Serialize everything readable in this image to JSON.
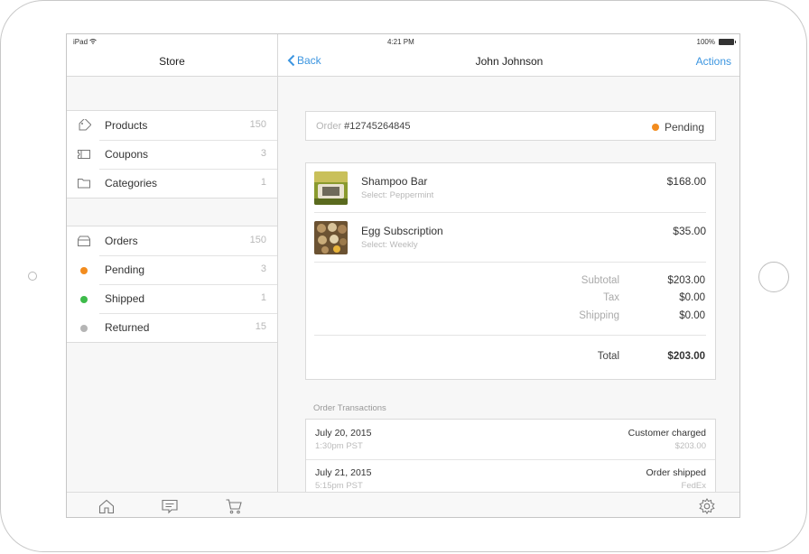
{
  "status_bar": {
    "device": "iPad",
    "time": "4:21 PM",
    "battery": "100%"
  },
  "sidebar": {
    "title": "Store",
    "catalog": [
      {
        "icon": "tag-icon",
        "label": "Products",
        "count": "150"
      },
      {
        "icon": "coupon-icon",
        "label": "Coupons",
        "count": "3"
      },
      {
        "icon": "folder-icon",
        "label": "Categories",
        "count": "1"
      }
    ],
    "orders": [
      {
        "icon": "inbox-icon",
        "label": "Orders",
        "count": "150"
      },
      {
        "icon": "pending-dot",
        "label": "Pending",
        "count": "3",
        "color": "#f28c1e"
      },
      {
        "icon": "shipped-dot",
        "label": "Shipped",
        "count": "1",
        "color": "#3dbb4a"
      },
      {
        "icon": "returned-dot",
        "label": "Returned",
        "count": "15",
        "color": "#b5b5b5"
      }
    ]
  },
  "header": {
    "back_label": "Back",
    "title": "John Johnson",
    "actions_label": "Actions"
  },
  "order": {
    "label": "Order",
    "number": "#12745264845",
    "status": "Pending",
    "status_color": "#f28c1e"
  },
  "items": [
    {
      "name": "Shampoo Bar",
      "option": "Select: Peppermint",
      "price": "$168.00"
    },
    {
      "name": "Egg Subscription",
      "option": "Select: Weekly",
      "price": "$35.00"
    }
  ],
  "summary": {
    "subtotal_label": "Subtotal",
    "subtotal": "$203.00",
    "tax_label": "Tax",
    "tax": "$0.00",
    "shipping_label": "Shipping",
    "shipping": "$0.00",
    "total_label": "Total",
    "total": "$203.00"
  },
  "transactions": {
    "heading": "Order Transactions",
    "rows": [
      {
        "date": "July 20, 2015",
        "time": "1:30pm PST",
        "event": "Customer charged",
        "detail": "$203.00"
      },
      {
        "date": "July 21, 2015",
        "time": "5:15pm PST",
        "event": "Order shipped",
        "detail": "FedEx"
      }
    ]
  },
  "tabbar": {
    "tabs": [
      "home-icon",
      "messages-icon",
      "cart-icon",
      "settings-icon"
    ]
  },
  "colors": {
    "accent": "#3b95e0"
  }
}
